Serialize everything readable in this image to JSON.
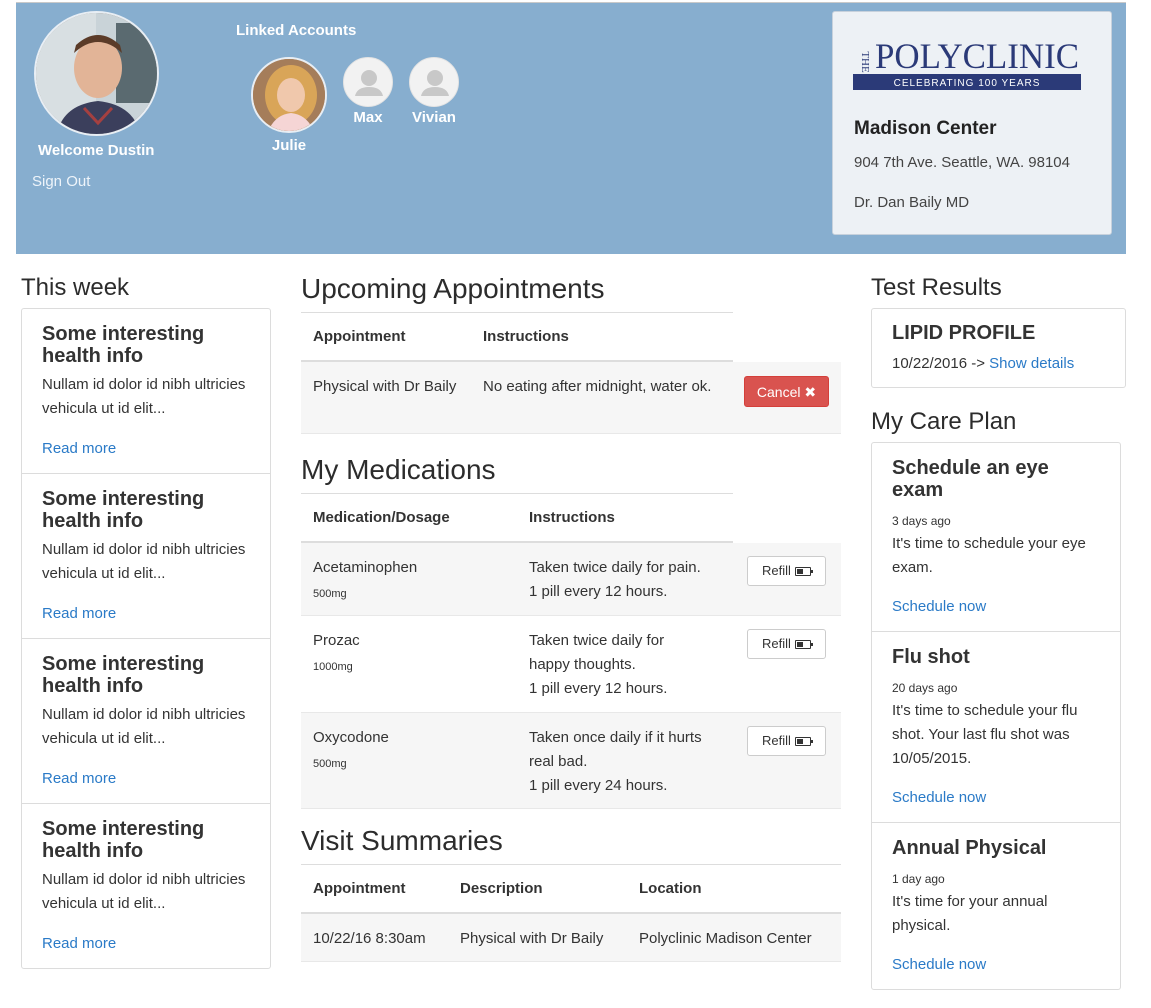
{
  "header": {
    "welcome": "Welcome Dustin",
    "sign_out": "Sign Out",
    "linked_title": "Linked Accounts",
    "linked_accounts": [
      {
        "name": "Julie"
      },
      {
        "name": "Max"
      },
      {
        "name": "Vivian"
      }
    ],
    "clinic": {
      "logo_the": "THE",
      "logo_name": "POLYCLINIC",
      "logo_tagline": "CELEBRATING 100 YEARS",
      "name": "Madison Center",
      "address": "904 7th Ave. Seattle, WA. 98104",
      "doctor": "Dr. Dan Baily MD"
    }
  },
  "this_week": {
    "title": "This week",
    "items": [
      {
        "title": "Some interesting health info",
        "body": "Nullam id dolor id nibh ultricies vehicula ut id elit...",
        "link": "Read more"
      },
      {
        "title": "Some interesting health info",
        "body": "Nullam id dolor id nibh ultricies vehicula ut id elit...",
        "link": "Read more"
      },
      {
        "title": "Some interesting health info",
        "body": "Nullam id dolor id nibh ultricies vehicula ut id elit...",
        "link": "Read more"
      },
      {
        "title": "Some interesting health info",
        "body": "Nullam id dolor id nibh ultricies vehicula ut id elit...",
        "link": "Read more"
      }
    ]
  },
  "appointments": {
    "title": "Upcoming Appointments",
    "headers": [
      "Appointment",
      "Instructions"
    ],
    "rows": [
      {
        "appointment": "Physical with Dr Baily",
        "instructions": "No eating after midnight, water ok.",
        "action": "Cancel ✖"
      }
    ]
  },
  "medications": {
    "title": "My Medications",
    "headers": [
      "Medication/Dosage",
      "Instructions"
    ],
    "rows": [
      {
        "name": "Acetaminophen",
        "dose": "500mg",
        "instructions": "Taken twice daily for pain.",
        "frequency": "1 pill every 12 hours.",
        "action": "Refill"
      },
      {
        "name": "Prozac",
        "dose": "1000mg",
        "instructions": "Taken twice daily for happy thoughts.",
        "frequency": "1 pill every 12 hours.",
        "action": "Refill"
      },
      {
        "name": "Oxycodone",
        "dose": "500mg",
        "instructions": "Taken once daily if it hurts real bad.",
        "frequency": "1 pill every 24 hours.",
        "action": "Refill"
      }
    ]
  },
  "visits": {
    "title": "Visit Summaries",
    "headers": [
      "Appointment",
      "Description",
      "Location"
    ],
    "rows": [
      {
        "appointment": "10/22/16 8:30am",
        "description": "Physical with Dr Baily",
        "location": "Polyclinic Madison Center"
      }
    ]
  },
  "test_results": {
    "title": "Test Results",
    "items": [
      {
        "name": "LIPID PROFILE",
        "date": "10/22/2016 ->",
        "link": "Show details"
      }
    ]
  },
  "care_plan": {
    "title": "My Care Plan",
    "items": [
      {
        "title": "Schedule an eye exam",
        "ago": "3 days ago",
        "body": "It's time to schedule your eye exam.",
        "link": "Schedule now"
      },
      {
        "title": "Flu shot",
        "ago": "20 days ago",
        "body": "It's time to schedule your flu shot. Your last flu shot was 10/05/2015.",
        "link": "Schedule now"
      },
      {
        "title": "Annual Physical",
        "ago": "1 day ago",
        "body": "It's time for your annual physical.",
        "link": "Schedule now"
      }
    ]
  },
  "colors": {
    "header_bg": "#87aecf",
    "link": "#2a7ac7",
    "cancel_bg": "#d9534f",
    "logo_navy": "#2b3a78"
  }
}
